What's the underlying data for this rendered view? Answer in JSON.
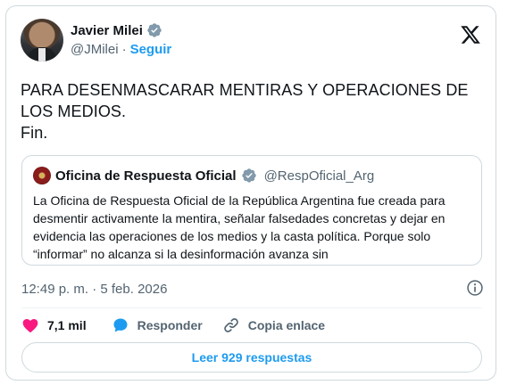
{
  "author": {
    "display_name": "Javier Milei",
    "handle": "@JMilei",
    "separator": "·",
    "follow_label": "Seguir",
    "verified_color": "#829aab"
  },
  "tweet": {
    "text": "PARA DESENMASCARAR MENTIRAS Y OPERACIONES DE\nLOS MEDIOS.\nFin."
  },
  "quoted_tweet": {
    "display_name": "Oficina de Respuesta Oficial",
    "handle": "@RespOficial_Arg",
    "text": "La Oficina de Respuesta Oficial de la República Argentina fue creada para desmentir activamente la mentira, señalar falsedades concretas y dejar en evidencia las operaciones de los medios y la casta política. Porque solo “informar” no alcanza si la desinformación avanza sin"
  },
  "meta": {
    "timestamp": "12:49 p. m. · 5 feb. 2026"
  },
  "actions": {
    "like_count": "7,1 mil",
    "reply_label": "Responder",
    "copy_label": "Copia enlace"
  },
  "replies_button": {
    "label": "Leer 929 respuestas"
  },
  "colors": {
    "accent": "#1d9bf0",
    "like": "#f91880",
    "text": "#0f1419",
    "secondary": "#536471",
    "border": "#cfd9de"
  },
  "icons": [
    "verified-icon",
    "x-logo-icon",
    "info-icon",
    "heart-icon",
    "reply-icon",
    "link-icon"
  ]
}
